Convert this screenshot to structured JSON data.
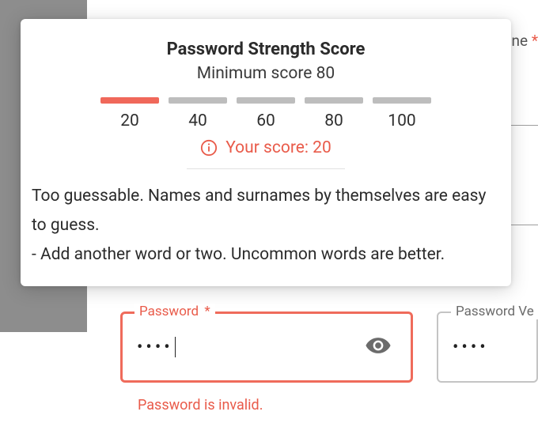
{
  "popover": {
    "title": "Password Strength Score",
    "subtitle": "Minimum score 80",
    "segments": [
      {
        "label": "20",
        "active": true
      },
      {
        "label": "40",
        "active": false
      },
      {
        "label": "60",
        "active": false
      },
      {
        "label": "80",
        "active": false
      },
      {
        "label": "100",
        "active": false
      }
    ],
    "score_text": "Your score: 20",
    "message_line1": "Too guessable. Names and surnames by themselves are easy to guess.",
    "message_line2": "- Add another word or two. Uncommon words are better."
  },
  "fields": {
    "password": {
      "label": "Password",
      "required_mark": "*",
      "masked_value": "••••",
      "error": "Password is invalid."
    },
    "verify": {
      "label": "Password Ve",
      "masked_value": "••••"
    }
  },
  "background": {
    "hint_text": "ne",
    "hint_asterisk": "*"
  }
}
